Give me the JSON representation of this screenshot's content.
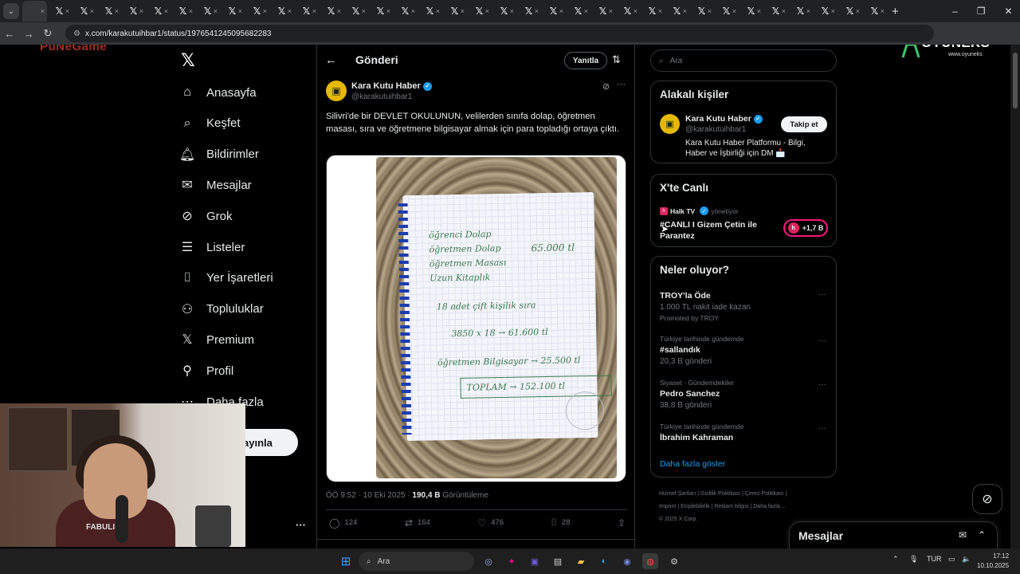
{
  "browser": {
    "tab_count_icon": "x-logo",
    "tab_close": "×",
    "url": "x.com/karakutuihbar1/status/1976541245095682283",
    "new_tab": "+"
  },
  "overlay": {
    "brand_left": "PuNeGame",
    "oyuneks_name": "OYUNEKS",
    "oyuneks_site": "www.oyuneks"
  },
  "nav": {
    "items": [
      {
        "label": "Anasayfa",
        "icon": "home-icon"
      },
      {
        "label": "Keşfet",
        "icon": "search-icon"
      },
      {
        "label": "Bildirimler",
        "icon": "bell-icon"
      },
      {
        "label": "Mesajlar",
        "icon": "mail-icon"
      },
      {
        "label": "Grok",
        "icon": "grok-icon"
      },
      {
        "label": "Listeler",
        "icon": "list-icon"
      },
      {
        "label": "Yer İşaretleri",
        "icon": "bookmark-icon"
      },
      {
        "label": "Topluluklar",
        "icon": "people-icon"
      },
      {
        "label": "Premium",
        "icon": "x-logo-icon"
      },
      {
        "label": "Profil",
        "icon": "user-icon"
      },
      {
        "label": "Daha fazla",
        "icon": "more-icon"
      }
    ],
    "post_button": "ayınla"
  },
  "webcam": {
    "shirt_text": "FABULI"
  },
  "main": {
    "title": "Gönderi",
    "reply_button": "Yanıtla",
    "author_name": "Kara Kutu Haber",
    "author_handle": "@karakutuihbar1",
    "text": "Silivri'de bir DEVLET OKULUNUN, velilerden sınıfa dolap, öğretmen masası, sıra ve öğretmene bilgisayar almak için para topladığı ortaya çıktı.",
    "time": "ÖÖ 9:52 · 10 Eki 2025 · ",
    "views": "190,4 B",
    "views_label": " Görüntüleme",
    "replies": "124",
    "reposts": "164",
    "likes": "476",
    "bookmarks": "28",
    "note_lines": [
      "öğrenci Dolap",
      "öğretmen Dolap",
      "öğretmen Masası",
      "Uzun Kitaplık",
      "65.000 tl",
      "18 adet çift kişilik sıra",
      "3850 x 18 → 61.600 tl",
      "öğretmen Bilgisayar → 25.500 tl",
      "TOPLAM → 152.100 tl"
    ]
  },
  "right": {
    "search_placeholder": "Ara",
    "related_title": "Alakalı kişiler",
    "related_name": "Kara Kutu Haber",
    "related_handle": "@karakutuihbar1",
    "related_bio": "Kara Kutu Haber Platformu - Bilgi, Haber ve İşbirliği için DM 📩",
    "follow_button": "Takip et",
    "live_title": "X'te Canlı",
    "live_source": "Halk TV",
    "live_managing": "yönetiyor",
    "live_stream": "#CANLI I Gizem Çetin ile Parantez",
    "live_count": "+1,7 B",
    "trends_title": "Neler oluyor?",
    "trends": [
      {
        "meta": "",
        "name": "TROY'la Öde",
        "sub": "1.000 TL nakit iade kazan",
        "extra": "Promoted by TROY"
      },
      {
        "meta": "Türkiye tarihinde gündemde",
        "name": "#sallandık",
        "sub": "20,3 B gönderi",
        "extra": ""
      },
      {
        "meta": "Siyaset · Gündemdekiler",
        "name": "Pedro Sanchez",
        "sub": "38,8 B gönderi",
        "extra": ""
      },
      {
        "meta": "Türkiye tarihinde gündemde",
        "name": "İbrahim Kahraman",
        "sub": "",
        "extra": ""
      }
    ],
    "show_more": "Daha fazla göster",
    "footer_line1": "Hizmet Şartları  |  Gizlilik Politikası  |  Çerez Politikası  |",
    "footer_line2": "Imprint  |  Erişilebilirlik  |  Reklam bilgisi  |  Daha fazla ...",
    "footer_line3": "© 2025 X Corp."
  },
  "messages_drawer": {
    "title": "Mesajlar"
  },
  "taskbar": {
    "search": "Ara",
    "lang": "TUR",
    "time": "17:12",
    "date": "10.10.2025"
  },
  "colors": {
    "accent": "#1d9bf0",
    "live": "#f91880",
    "verified": "#1d9bf0"
  }
}
